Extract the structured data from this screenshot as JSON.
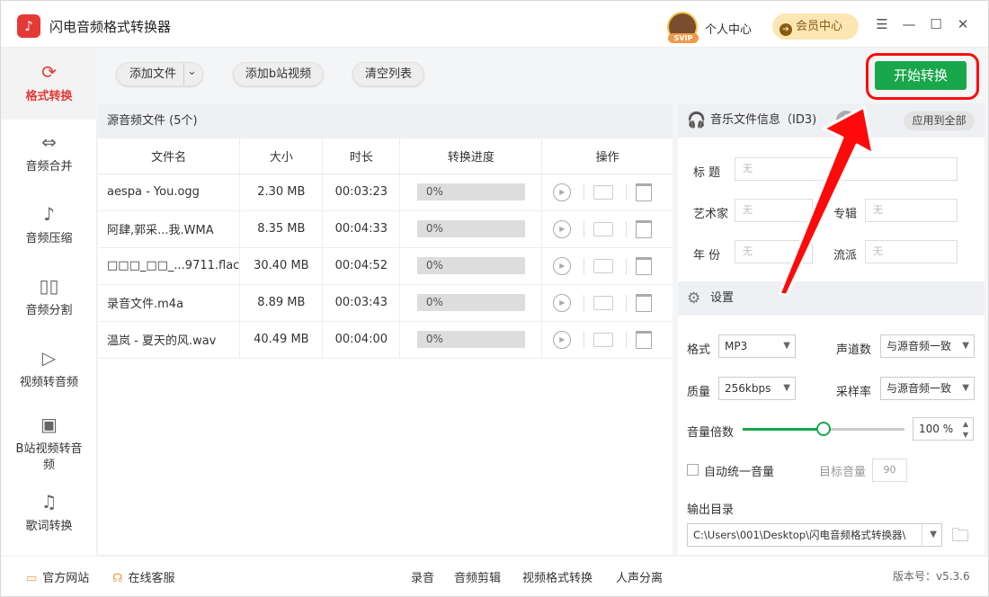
{
  "app": {
    "title": "闪电音频格式转换器",
    "logo_glyph": "♪",
    "user_center": "个人中心",
    "svip_badge": "SVIP",
    "vip_center": "会员中心",
    "vip_glyph": "➔",
    "window_controls": {
      "menu": "☰",
      "minimize": "—",
      "maximize": "☐",
      "close": "✕"
    }
  },
  "sidebar": {
    "items": [
      {
        "label": "格式转换",
        "icon": "refresh-icon",
        "glyph": "⟳"
      },
      {
        "label": "音频合并",
        "icon": "merge-icon",
        "glyph": "⇔"
      },
      {
        "label": "音频压缩",
        "icon": "compress-icon",
        "glyph": "♪"
      },
      {
        "label": "音频分割",
        "icon": "split-icon",
        "glyph": "▯▯"
      },
      {
        "label": "视频转音频",
        "icon": "video-to-audio-icon",
        "glyph": "▷"
      },
      {
        "label": "B站视频转音频",
        "icon": "bilibili-icon",
        "glyph": "▣"
      },
      {
        "label": "歌词转换",
        "icon": "lyrics-icon",
        "glyph": "♫"
      }
    ]
  },
  "toolbar": {
    "add_file": "添加文件",
    "add_file_arrow": "⌄",
    "add_bilibili": "添加b站视频",
    "clear_list": "清空列表",
    "start": "开始转换"
  },
  "file_list": {
    "header": "源音频文件 (5个)",
    "columns": [
      "文件名",
      "大小",
      "时长",
      "转换进度",
      "操作"
    ],
    "rows": [
      {
        "name": "aespa - You.ogg",
        "size": "2.30 MB",
        "duration": "00:03:23",
        "progress": "0%"
      },
      {
        "name": "阿肆,郭采...我.WMA",
        "size": "8.35 MB",
        "duration": "00:04:33",
        "progress": "0%"
      },
      {
        "name": "□□□_□□_...9711.flac",
        "size": "30.40 MB",
        "duration": "00:04:52",
        "progress": "0%"
      },
      {
        "name": "录音文件.m4a",
        "size": "8.89 MB",
        "duration": "00:03:43",
        "progress": "0%"
      },
      {
        "name": "温岚 - 夏天的风.wav",
        "size": "40.49 MB",
        "duration": "00:04:00",
        "progress": "0%"
      }
    ],
    "play_glyph": "▶"
  },
  "id3": {
    "title": "音乐文件信息（ID3)",
    "warn_glyph": "!",
    "headphone_glyph": "🎧",
    "apply_all": "应用到全部",
    "fields": {
      "title_label": "标 题",
      "title_value": "无",
      "artist_label": "艺术家",
      "artist_value": "无",
      "album_label": "专辑",
      "album_value": "无",
      "year_label": "年 份",
      "year_value": "无",
      "genre_label": "流派",
      "genre_value": "无"
    }
  },
  "settings": {
    "title": "设置",
    "gear_glyph": "⚙",
    "format_label": "格式",
    "format_value": "MP3",
    "channel_label": "声道数",
    "channel_value": "与源音频一致",
    "quality_label": "质量",
    "quality_value": "256kbps",
    "sample_label": "采样率",
    "sample_value": "与源音频一致",
    "volume_label": "音量倍数",
    "volume_value": "100",
    "volume_unit": "%",
    "volume_level": 0.5,
    "auto_volume_label": "自动统一音量",
    "target_label": "目标音量",
    "target_value": "90",
    "output_label": "输出目录",
    "output_path": "C:\\Users\\001\\Desktop\\闪电音频格式转换器\\",
    "dropdown_glyph": "▼",
    "folder_glyph": "🗀"
  },
  "footer": {
    "website": "官方网站",
    "support": "在线客服",
    "links": [
      "录音",
      "音频剪辑",
      "视频格式转换",
      "人声分离"
    ],
    "version": "版本号：v5.3.6",
    "website_glyph": "▭",
    "support_glyph": "☊"
  },
  "colors": {
    "accent_green": "#18a74b",
    "highlight_red": "#ff0a0a",
    "active_red": "#e53935",
    "vip_gold": "#fce7b3"
  }
}
